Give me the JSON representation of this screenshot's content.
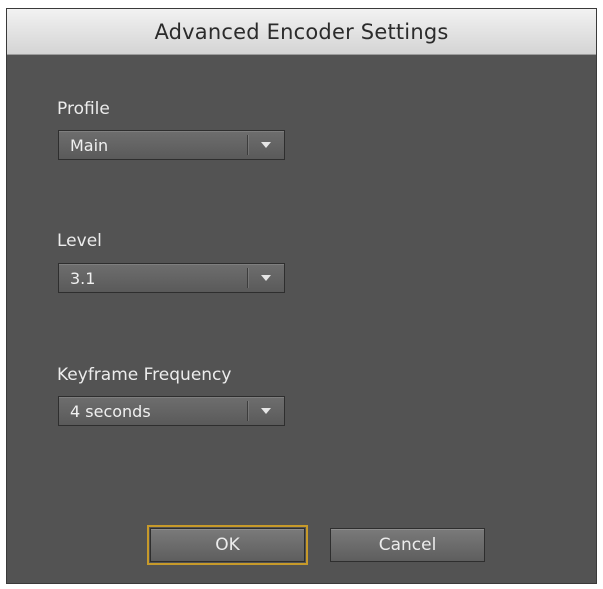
{
  "dialog": {
    "title": "Advanced Encoder Settings"
  },
  "fields": {
    "profile": {
      "label": "Profile",
      "value": "Main",
      "arrow_icon": "dropdown-arrow-icon"
    },
    "level": {
      "label": "Level",
      "value": "3.1",
      "arrow_icon": "dropdown-arrow-icon"
    },
    "keyframe": {
      "label": "Keyframe Frequency",
      "value": "4 seconds",
      "arrow_icon": "dropdown-arrow-icon"
    }
  },
  "buttons": {
    "ok_label": "OK",
    "cancel_label": "Cancel"
  },
  "colors": {
    "panel": "#535353",
    "default_button_focus": "#c79a2a"
  }
}
